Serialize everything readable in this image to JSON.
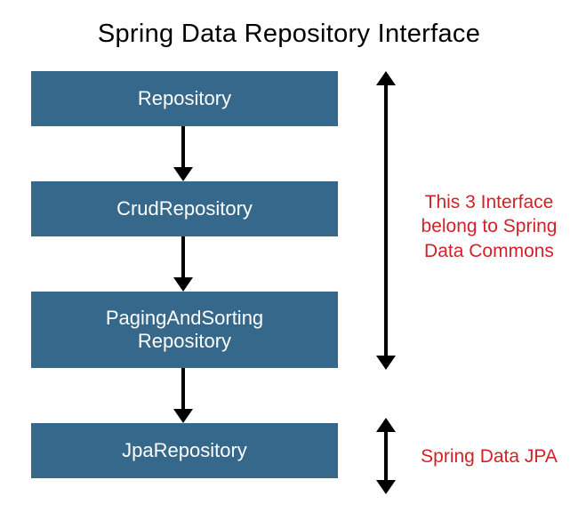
{
  "title": "Spring Data Repository Interface",
  "boxes": {
    "b1": "Repository",
    "b2": "CrudRepository",
    "b3": "PagingAndSorting\nRepository",
    "b4": "JpaRepository"
  },
  "annotations": {
    "commons": "This 3 Interface belong to Spring Data Commons",
    "jpa": "Spring Data JPA"
  }
}
